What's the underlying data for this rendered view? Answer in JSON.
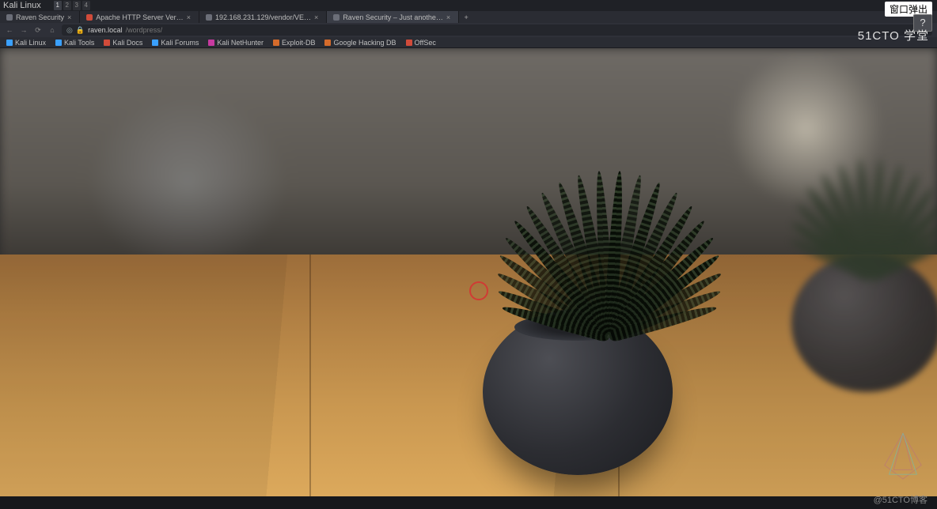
{
  "titlebar": {
    "app": "Kali Linux",
    "icon_colors": [
      "#3aa0ff",
      "#f0b431",
      "#7c74d5",
      "#d54b3f",
      "#3c3f47",
      "#3c3f47",
      "#3c3f47",
      "#d56b2b"
    ],
    "workspaces": [
      "1",
      "2",
      "3",
      "4"
    ],
    "active_workspace": 0
  },
  "tabs": [
    {
      "label": "Raven Security",
      "favicon": "#6b6e78",
      "active": false
    },
    {
      "label": "Apache HTTP Server Ver…",
      "favicon": "#d14b3a",
      "active": false
    },
    {
      "label": "192.168.231.129/vendor/VE…",
      "favicon": "#6b6e78",
      "active": false
    },
    {
      "label": "Raven Security – Just anothe…",
      "favicon": "#6b6e78",
      "active": true
    }
  ],
  "newtab_glyph": "+",
  "toolbar": {
    "back": "←",
    "fwd": "→",
    "reload": "⟳",
    "home": "⌂",
    "shield": "◎",
    "lock": "🔒",
    "url_host": "raven.local",
    "url_path": "/wordpress/"
  },
  "bookmarks": [
    {
      "label": "Kali Linux",
      "color": "#3aa0ff"
    },
    {
      "label": "Kali Tools",
      "color": "#3aa0ff"
    },
    {
      "label": "Kali Docs",
      "color": "#d14b3a"
    },
    {
      "label": "Kali Forums",
      "color": "#3aa0ff"
    },
    {
      "label": "Kali NetHunter",
      "color": "#c73aa0"
    },
    {
      "label": "Exploit-DB",
      "color": "#d56b2b"
    },
    {
      "label": "Google Hacking DB",
      "color": "#d56b2b"
    },
    {
      "label": "OffSec",
      "color": "#d14b3a"
    }
  ],
  "overlay": {
    "popup": "窗口弹出",
    "help": "?",
    "brand_top": "51CTO 学堂",
    "brand_bottom": "@51CTO博客"
  }
}
